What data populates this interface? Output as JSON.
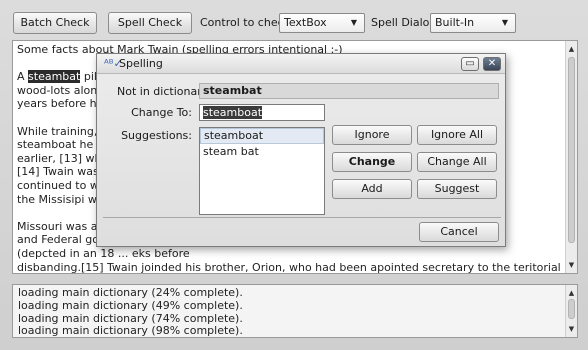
{
  "toolbar": {
    "batch_check_label": "Batch Check",
    "spell_check_label": "Spell Check",
    "control_label": "Control to check:",
    "control_value": "TextBox",
    "dialog_label": "Spell Dialog:",
    "dialog_value": "Built-In"
  },
  "document": {
    "paragraphs": [
      {
        "before": "Some facts about Mark Twain (spelling errors intentional :-)",
        "highlight": "",
        "after": ""
      },
      {
        "before": "A ",
        "highlight": "steambat",
        "after": " pilot must know ... ports and\nwood-lots along th ... an two\nyears before he re"
      },
      {
        "before": "While training, Sa ... , when the\nsteamboat he was ... month\nearlier, [13] which ... Research.\n[14] Twain was gu ... er, he\ncontinued to work ... ffic along\nthe Missisipi was",
        "highlight": "",
        "after": ""
      },
      {
        "before": "Missouri was a sla ... nfederate\nand Federal gover ... e militia\n(depcted in an 18 ... eks before\ndisbanding.[15] Twain joinded his brother, Orion, who had been apointed secretary to the teritorial govenor of Nevada,\nJames W. Nye, and headed west.",
        "highlight": "",
        "after": ""
      }
    ]
  },
  "log": {
    "lines": [
      "loading main dictionary (24% complete).",
      "loading main dictionary (49% complete).",
      "loading main dictionary (74% complete).",
      "loading main dictionary (98% complete)."
    ]
  },
  "dialog": {
    "title": "Spelling",
    "not_in_dictionary_label": "Not in dictionary:",
    "not_in_dictionary_value": "steambat",
    "change_to_label": "Change To:",
    "change_to_value": "steamboat",
    "suggestions_label": "Suggestions:",
    "suggestions": [
      "steamboat",
      "steam bat"
    ],
    "buttons": {
      "ignore": "Ignore",
      "ignore_all": "Ignore All",
      "change": "Change",
      "change_all": "Change All",
      "add": "Add",
      "suggest": "Suggest",
      "cancel": "Cancel"
    },
    "minimize_glyph": "▭",
    "close_glyph": "✕"
  }
}
